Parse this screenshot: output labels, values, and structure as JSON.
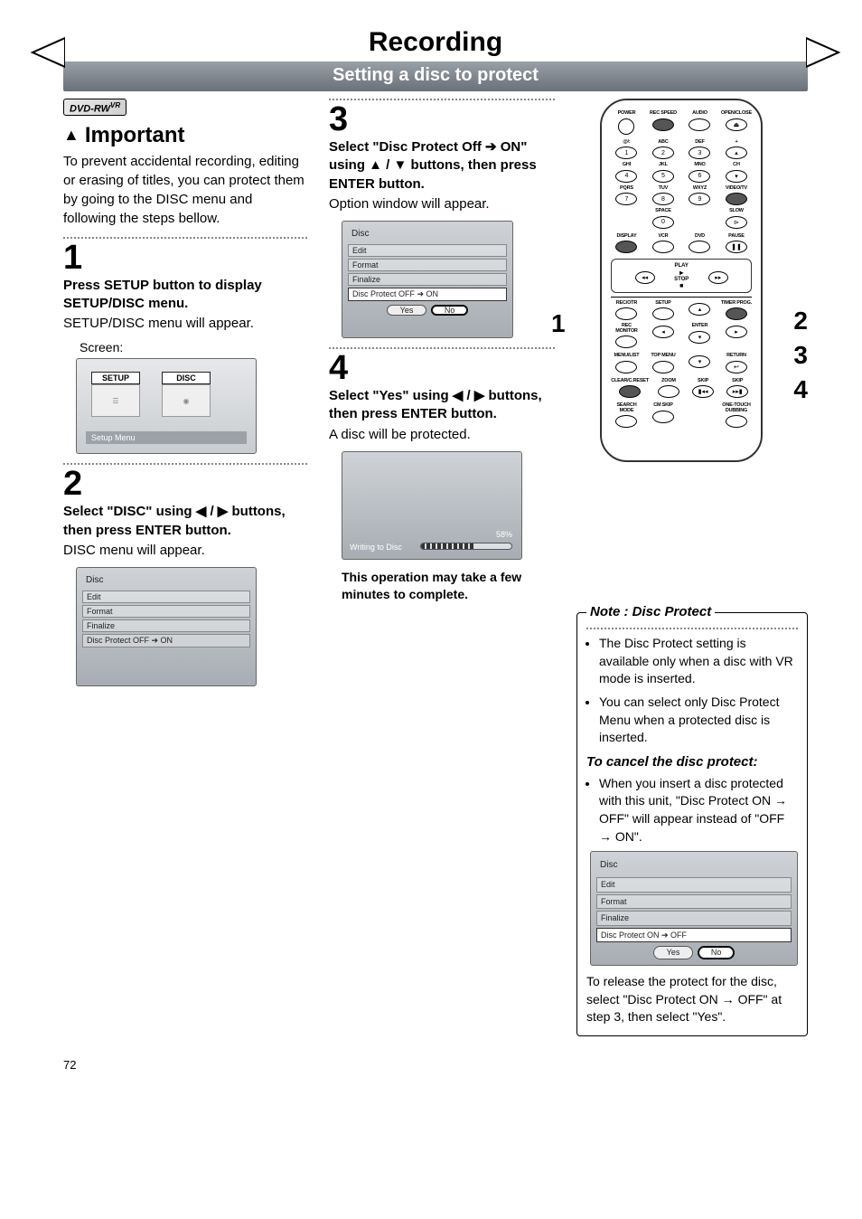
{
  "page_title": "Recording",
  "sub_banner": "Setting a disc to protect",
  "badge": "DVD-RW",
  "badge_super": "VR",
  "important_heading": "Important",
  "important_body": "To prevent accidental recording, editing or erasing of titles, you can protect them by going to the DISC menu and following the steps bellow.",
  "step1": {
    "num": "1",
    "bold": "Press SETUP button to display SETUP/DISC menu.",
    "body": "SETUP/DISC menu will appear.",
    "screen_label": "Screen:",
    "setup_tab": "SETUP",
    "disc_tab": "DISC",
    "footer": "Setup Menu"
  },
  "step2": {
    "num": "2",
    "bold": "Select \"DISC\" using ◀ / ▶ buttons, then press ENTER button.",
    "body": "DISC menu will appear.",
    "menu_title": "Disc",
    "rows": [
      "Edit",
      "Format",
      "Finalize",
      "Disc Protect OFF ➔ ON"
    ]
  },
  "step3": {
    "num": "3",
    "bold": "Select \"Disc Protect Off ➔ ON\" using ▲ / ▼ buttons, then press ENTER button.",
    "body": "Option window will appear.",
    "menu_title": "Disc",
    "rows": [
      "Edit",
      "Format",
      "Finalize",
      "Disc Protect OFF ➔ ON"
    ],
    "yes": "Yes",
    "no": "No"
  },
  "step4": {
    "num": "4",
    "bold": "Select \"Yes\" using ◀ / ▶ buttons, then press ENTER button.",
    "body": "A disc will be protected.",
    "progress_label": "Writing to Disc",
    "progress_pct": "58%",
    "progress_value": 58,
    "warn": "This operation may take a few minutes to complete."
  },
  "remote": {
    "row1": [
      "POWER",
      "REC SPEED",
      "AUDIO",
      "OPEN/CLOSE"
    ],
    "numpad": [
      {
        "sup": "@/:",
        "n": "1"
      },
      {
        "sup": "ABC",
        "n": "2"
      },
      {
        "sup": "DEF",
        "n": "3"
      },
      {
        "sup": "+",
        "n": ""
      },
      {
        "sup": "GHI",
        "n": "4"
      },
      {
        "sup": "JKL",
        "n": "5"
      },
      {
        "sup": "MNO",
        "n": "6"
      },
      {
        "sup": "CH",
        "n": ""
      },
      {
        "sup": "PQRS",
        "n": "7"
      },
      {
        "sup": "TUV",
        "n": "8"
      },
      {
        "sup": "WXYZ",
        "n": "9"
      },
      {
        "sup": "VIDEO/TV",
        "n": ""
      },
      {
        "sup": "",
        "n": ""
      },
      {
        "sup": "SPACE",
        "n": "0"
      },
      {
        "sup": "",
        "n": ""
      },
      {
        "sup": "SLOW",
        "n": ""
      }
    ],
    "row3": [
      "DISPLAY",
      "VCR",
      "DVD",
      "PAUSE"
    ],
    "play": "PLAY",
    "stop": "STOP",
    "row4": [
      "REC/OTR",
      "SETUP",
      "",
      "TIMER PROG."
    ],
    "row5": [
      "REC MONITOR",
      "",
      "ENTER",
      ""
    ],
    "row6": [
      "MENU/LIST",
      "TOP MENU",
      "",
      "RETURN"
    ],
    "row7": [
      "CLEAR/C.RESET",
      "ZOOM",
      "SKIP",
      "SKIP"
    ],
    "row8": [
      "SEARCH MODE",
      "CM SKIP",
      "",
      "ONE-TOUCH DUBBING"
    ],
    "left_ind": "1",
    "right_inds": [
      "2",
      "3",
      "4"
    ]
  },
  "note": {
    "title": "Note : Disc Protect",
    "bullets": [
      "The Disc Protect setting is available only when a disc with VR mode is inserted.",
      "You can select only Disc Protect Menu when a protected disc is inserted."
    ],
    "cancel_heading": "To cancel the disc protect:",
    "cancel_bullet": "When you insert a disc protected with this unit, \"Disc Protect ON → OFF\" will appear instead of \"OFF → ON\".",
    "menu_title": "Disc",
    "rows": [
      "Edit",
      "Format",
      "Finalize",
      "Disc Protect ON ➔ OFF"
    ],
    "yes": "Yes",
    "no": "No",
    "tail": "To release the protect for the disc, select \"Disc Protect ON → OFF\" at step 3, then select \"Yes\"."
  },
  "page_number": "72"
}
